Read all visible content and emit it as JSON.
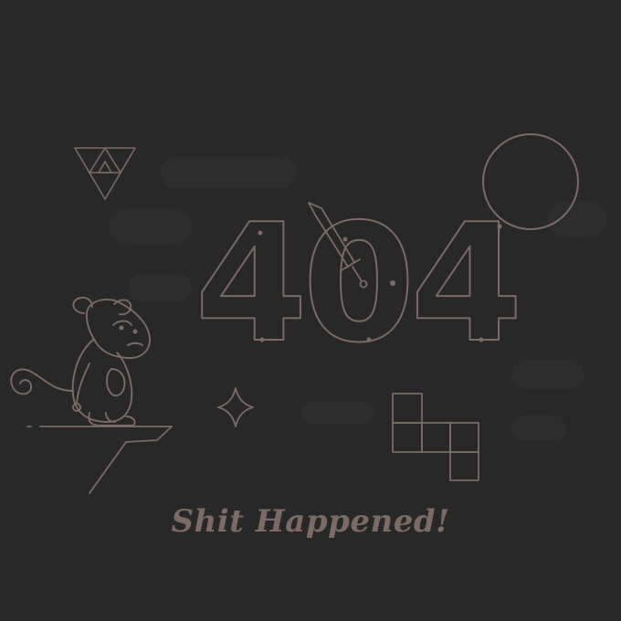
{
  "page": {
    "error_code": "404",
    "message": "Shit Happened!"
  },
  "colors": {
    "background": "#282828",
    "line": "#7b6a66",
    "shadow": "#2e2d2d"
  },
  "illustrations": [
    "triforce-icon",
    "moon-icon",
    "sword-icon",
    "monkey-icon",
    "cliff-icon",
    "sparkle-icon",
    "tetris-piece-icon"
  ]
}
